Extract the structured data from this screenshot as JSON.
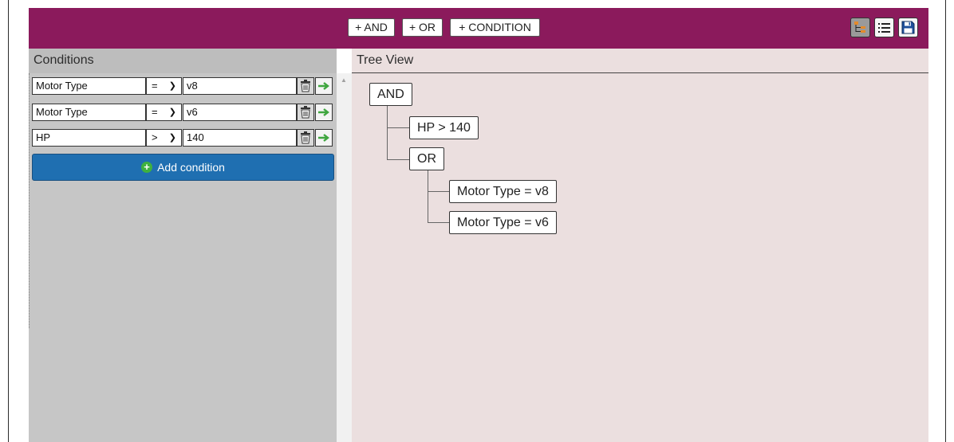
{
  "toolbar": {
    "and_label": "+ AND",
    "or_label": "+ OR",
    "condition_label": "+ CONDITION",
    "accent_color": "#8b1a5c"
  },
  "view_buttons": [
    {
      "icon": "tree-view-icon"
    },
    {
      "icon": "list-view-icon"
    },
    {
      "icon": "save-icon"
    }
  ],
  "conditions_panel": {
    "title": "Conditions",
    "rows": [
      {
        "field": "Motor Type",
        "operator": "=",
        "value": "v8"
      },
      {
        "field": "Motor Type",
        "operator": "=",
        "value": "v6"
      },
      {
        "field": "HP",
        "operator": ">",
        "value": "140"
      }
    ],
    "add_label": "Add condition"
  },
  "tree_panel": {
    "title": "Tree View",
    "nodes": {
      "root": "AND",
      "hp": "HP > 140",
      "or": "OR",
      "v8": "Motor Type = v8",
      "v6": "Motor Type = v6"
    }
  }
}
